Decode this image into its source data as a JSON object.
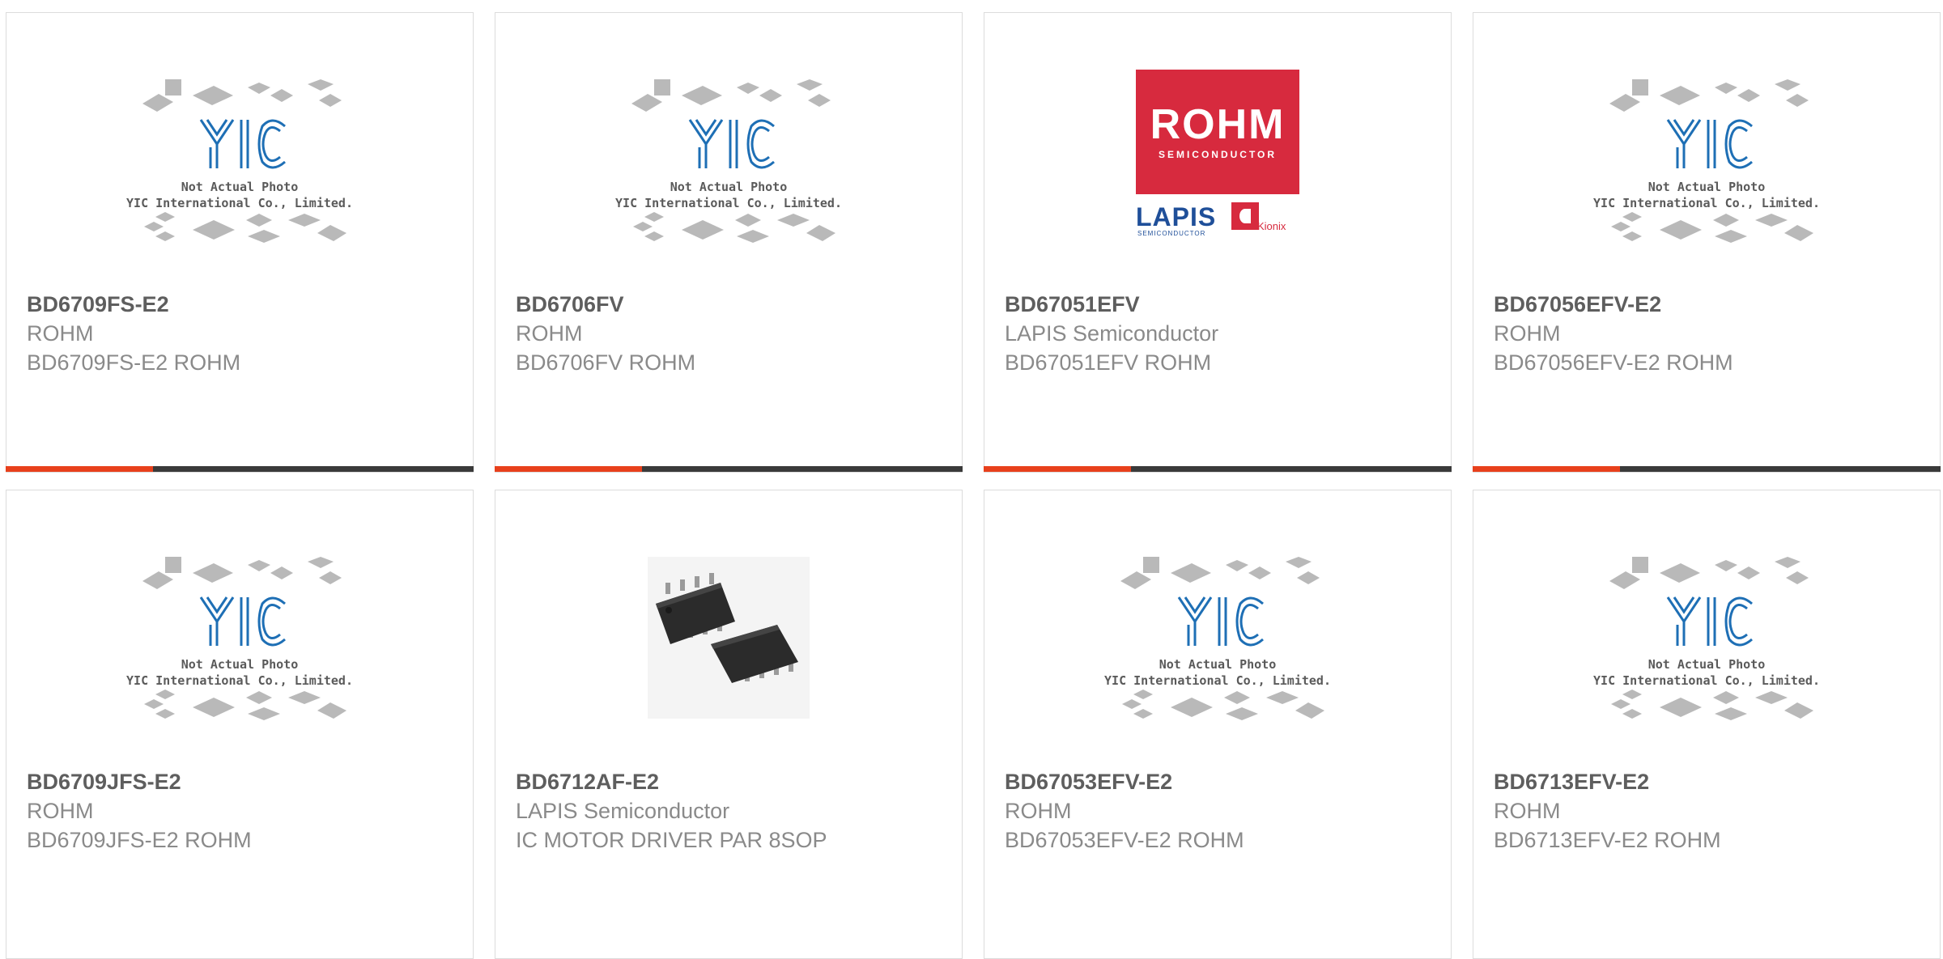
{
  "products": [
    {
      "part": "BD6709FS-E2",
      "manufacturer": "ROHM",
      "description": "BD6709FS-E2 ROHM",
      "image": "placeholder"
    },
    {
      "part": "BD6706FV",
      "manufacturer": "ROHM",
      "description": "BD6706FV ROHM",
      "image": "placeholder"
    },
    {
      "part": "BD67051EFV",
      "manufacturer": "LAPIS Semiconductor",
      "description": "BD67051EFV ROHM",
      "image": "rohm-logo"
    },
    {
      "part": "BD67056EFV-E2",
      "manufacturer": "ROHM",
      "description": "BD67056EFV-E2 ROHM",
      "image": "placeholder"
    },
    {
      "part": "BD6709JFS-E2",
      "manufacturer": "ROHM",
      "description": "BD6709JFS-E2 ROHM",
      "image": "placeholder"
    },
    {
      "part": "BD6712AF-E2",
      "manufacturer": "LAPIS Semiconductor",
      "description": "IC MOTOR DRIVER PAR 8SOP",
      "image": "sop8-photo"
    },
    {
      "part": "BD67053EFV-E2",
      "manufacturer": "ROHM",
      "description": "BD67053EFV-E2 ROHM",
      "image": "placeholder"
    },
    {
      "part": "BD6713EFV-E2",
      "manufacturer": "ROHM",
      "description": "BD6713EFV-E2 ROHM",
      "image": "placeholder"
    }
  ],
  "placeholder": {
    "line1": "Not Actual Photo",
    "line2": "YIC International Co., Limited."
  },
  "rohm_logo": {
    "word": "ROHM",
    "sub": "SEMICONDUCTOR",
    "lapis": "LAPIS",
    "lapis_sub": "SEMICONDUCTOR",
    "kionix": "Kionix"
  },
  "colors": {
    "accent": "#e8401c",
    "bar": "#3a3a3a",
    "logo_blue": "#1e6fb5",
    "rohm_red": "#d72a3e"
  }
}
